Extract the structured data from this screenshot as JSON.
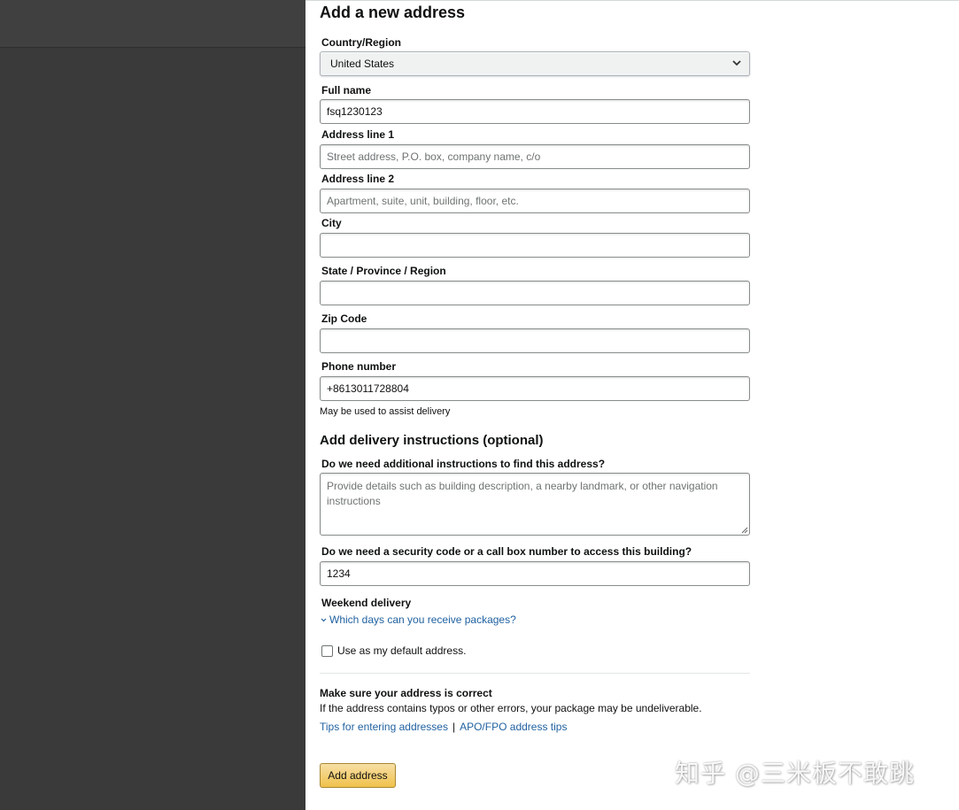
{
  "page_title": "Add a new address",
  "fields": {
    "country": {
      "label": "Country/Region",
      "value": "United States"
    },
    "full_name": {
      "label": "Full name",
      "value": "fsq1230123"
    },
    "address1": {
      "label": "Address line 1",
      "placeholder": "Street address, P.O. box, company name, c/o"
    },
    "address2": {
      "label": "Address line 2",
      "placeholder": "Apartment, suite, unit, building, floor, etc."
    },
    "city": {
      "label": "City",
      "value": ""
    },
    "state": {
      "label": "State / Province / Region",
      "value": ""
    },
    "zip": {
      "label": "Zip Code",
      "value": ""
    },
    "phone": {
      "label": "Phone number",
      "value": "+8613011728804",
      "hint": "May be used to assist delivery"
    }
  },
  "delivery": {
    "title": "Add delivery instructions (optional)",
    "find_label": "Do we need additional instructions to find this address?",
    "find_placeholder": "Provide details such as building description, a nearby landmark, or other navigation instructions",
    "security_label": "Do we need a security code or a call box number to access this building?",
    "security_value": "1234",
    "weekend_label": "Weekend delivery",
    "weekend_link": "Which days can you receive packages?"
  },
  "default_checkbox": {
    "label": "Use as my default address.",
    "checked": false
  },
  "notice": {
    "title": "Make sure your address is correct",
    "text": "If the address contains typos or other errors, your package may be undeliverable.",
    "tips_link": "Tips for entering addresses",
    "separator": "|",
    "apo_link": "APO/FPO address tips"
  },
  "submit_label": "Add address",
  "watermark": "知乎 @三米板不敢跳",
  "colors": {
    "link": "#2162a1",
    "button": "#f0c14b",
    "dark_panel": "#3a3a3a"
  }
}
